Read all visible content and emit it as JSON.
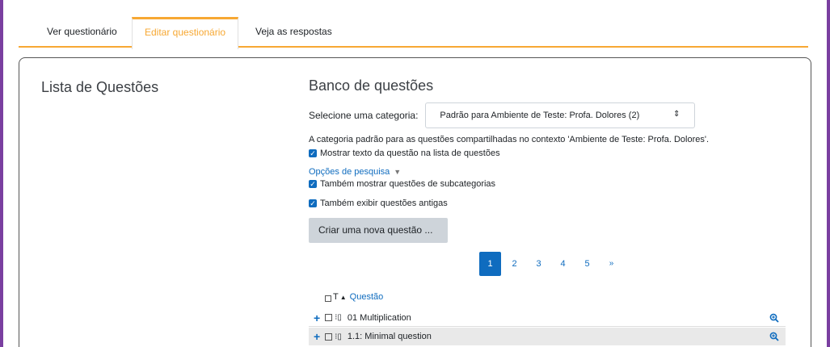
{
  "tabs": [
    {
      "label": "Ver questionário",
      "active": false
    },
    {
      "label": "Editar questionário",
      "active": true
    },
    {
      "label": "Veja as respostas",
      "active": false
    }
  ],
  "left_title": "Lista de Questões",
  "bank": {
    "title": "Banco de questões",
    "category_label": "Selecione uma categoria:",
    "category_selected": "Padrão para Ambiente de Teste: Profa. Dolores (2)",
    "category_description": "A categoria padrão para as questões compartilhadas no contexto 'Ambiente de Teste: Profa. Dolores'.",
    "show_text_label": "Mostrar texto da questão na lista de questões",
    "search_options_label": "Opções de pesquisa",
    "subcategories_label": "Também mostrar questões de subcategorias",
    "old_questions_label": "Também exibir questões antigas",
    "create_button": "Criar uma nova questão ..."
  },
  "pagination": {
    "pages": [
      "1",
      "2",
      "3",
      "4",
      "5"
    ],
    "current": "1",
    "next": "»"
  },
  "table": {
    "type_header": "T",
    "question_header": "Questão",
    "rows": [
      {
        "name": "01 Multiplication"
      },
      {
        "name": "1.1: Minimal question"
      }
    ]
  },
  "colors": {
    "accent": "#f7a833",
    "primary": "#0f6cbf",
    "frame": "#7a3fa0"
  }
}
